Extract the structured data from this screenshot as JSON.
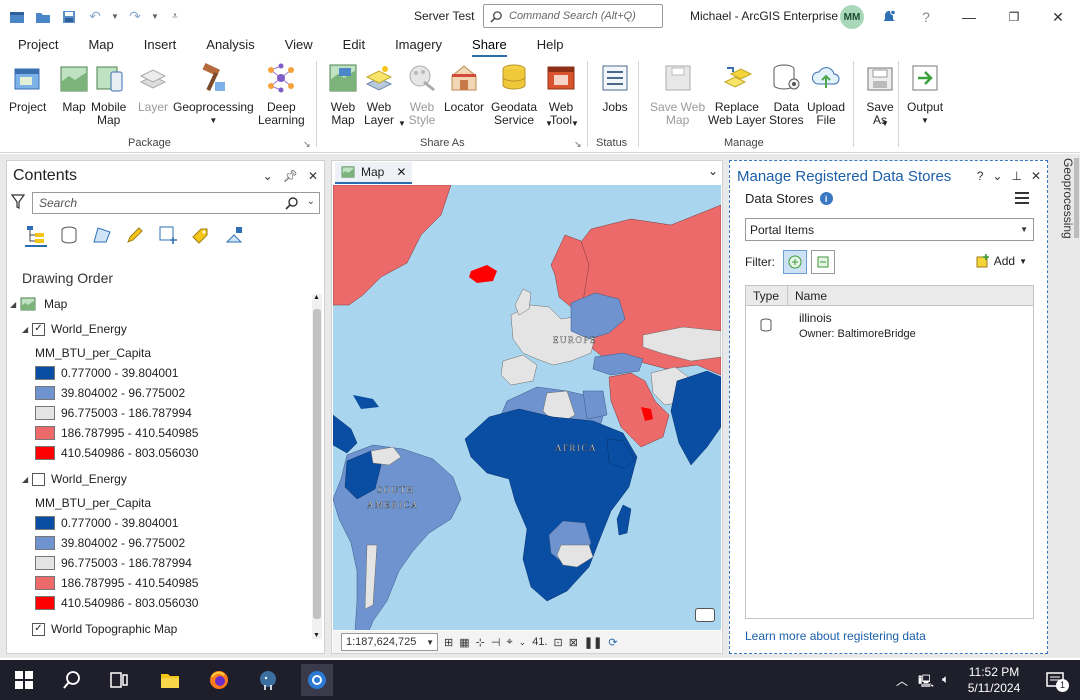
{
  "titlebar": {
    "title": "Server Test",
    "search_placeholder": "Command Search (Alt+Q)",
    "user": "Michael - ArcGIS Enterprise",
    "avatar": "MM",
    "help": "?",
    "minimize": "—",
    "restore": "❐",
    "close": "✕"
  },
  "tabs": [
    "Project",
    "Map",
    "Insert",
    "Analysis",
    "View",
    "Edit",
    "Imagery",
    "Share",
    "Help"
  ],
  "active_tab": "Share",
  "ribbon": {
    "package": {
      "label": "Package",
      "buttons": [
        "Project",
        "Map",
        "Mobile\nMap",
        "Layer",
        "Geoprocessing",
        "Deep\nLearning"
      ]
    },
    "share_as": {
      "label": "Share As",
      "buttons": [
        "Web\nMap",
        "Web\nLayer",
        "Web\nStyle",
        "Locator",
        "Geodata\nService",
        "Web\nTool"
      ]
    },
    "status": {
      "label": "Status",
      "buttons": [
        "Jobs"
      ]
    },
    "manage": {
      "label": "Manage",
      "buttons": [
        "Save Web\nMap",
        "Replace\nWeb Layer",
        "Data\nStores",
        "Upload\nFile",
        "Save\nAs"
      ]
    },
    "output": {
      "buttons": [
        "Output"
      ]
    }
  },
  "contents": {
    "title": "Contents",
    "search_placeholder": "Search",
    "section": "Drawing Order",
    "map_name": "Map",
    "layers": [
      {
        "name": "World_Energy",
        "checked": true,
        "field": "MM_BTU_per_Capita",
        "classes": [
          {
            "label": "0.777000 - 39.804001",
            "color": "#0a4ea3"
          },
          {
            "label": "39.804002 - 96.775002",
            "color": "#6e93cf"
          },
          {
            "label": "96.775003 - 186.787994",
            "color": "#e4e4e4"
          },
          {
            "label": "186.787995 - 410.540985",
            "color": "#ec6a6a"
          },
          {
            "label": "410.540986 - 803.056030",
            "color": "#ff0000"
          }
        ]
      },
      {
        "name": "World_Energy",
        "checked": false,
        "field": "MM_BTU_per_Capita",
        "classes": [
          {
            "label": "0.777000 - 39.804001",
            "color": "#0a4ea3"
          },
          {
            "label": "39.804002 - 96.775002",
            "color": "#6e93cf"
          },
          {
            "label": "96.775003 - 186.787994",
            "color": "#e4e4e4"
          },
          {
            "label": "186.787995 - 410.540985",
            "color": "#ec6a6a"
          },
          {
            "label": "410.540986 - 803.056030",
            "color": "#ff0000"
          }
        ]
      }
    ],
    "basemap": {
      "name": "World Topographic Map",
      "checked": true
    }
  },
  "mapview": {
    "tab_label": "Map",
    "scale": "1:187,624,725",
    "labels": {
      "europe": "EUROPE",
      "africa": "AFRICA",
      "south_america_1": "SOUTH",
      "south_america_2": "AMERICA"
    },
    "status_extra": "41."
  },
  "datastores": {
    "title": "Manage Registered Data Stores",
    "subtitle": "Data Stores",
    "select_value": "Portal Items",
    "filter_label": "Filter:",
    "add_label": "Add",
    "columns": [
      "Type",
      "Name"
    ],
    "rows": [
      {
        "name": "illinois",
        "owner": "Owner:  BaltimoreBridge"
      }
    ],
    "learn_more": "Learn more about registering data",
    "side_tab": "Geoprocessing"
  },
  "taskbar": {
    "time": "11:52 PM",
    "date": "5/11/2024",
    "notifications": "1"
  },
  "colors": {
    "accent": "#2b6cb0",
    "low": "#0a4ea3",
    "midlow": "#6e93cf",
    "mid": "#e4e4e4",
    "midhigh": "#ec6a6a",
    "high": "#ff0000",
    "ocean": "#a9d6ee"
  }
}
